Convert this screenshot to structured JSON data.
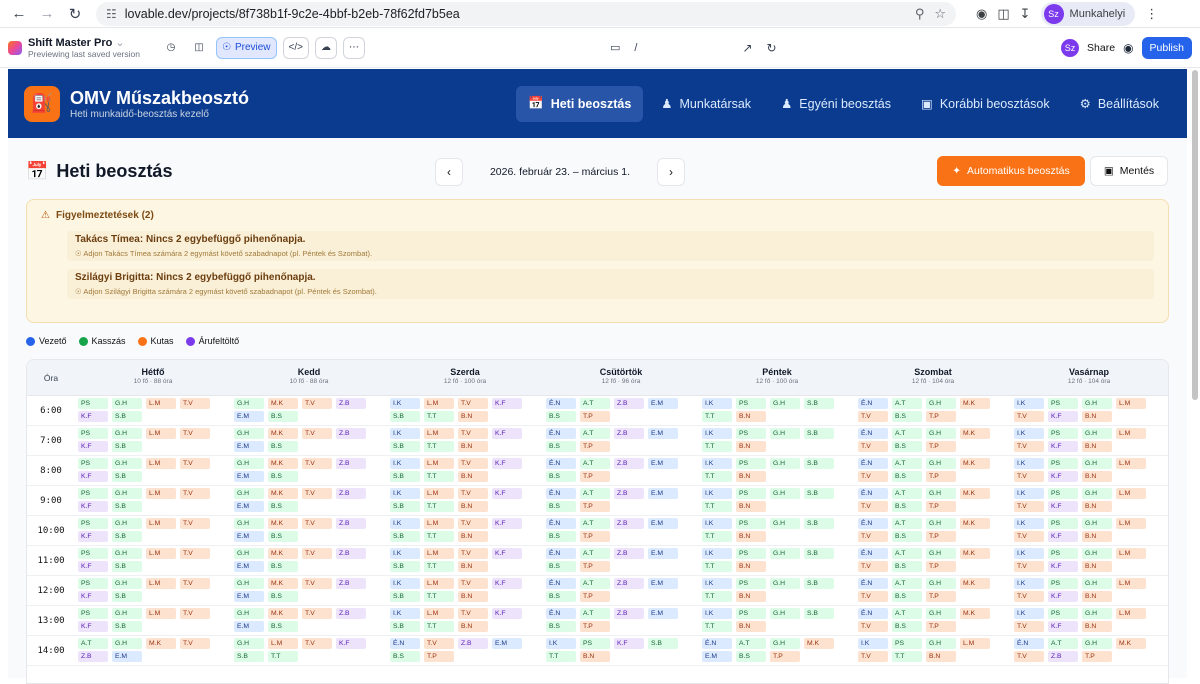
{
  "browser": {
    "url": "lovable.dev/projects/8f738b1f-9c2e-4bbf-b2eb-78f62fd7b5ea",
    "profile_initials": "Sz",
    "profile_name": "Munkahelyi"
  },
  "lovable": {
    "project_name": "Shift Master Pro",
    "project_sub": "Previewing last saved version",
    "preview_label": "Preview",
    "path": "/",
    "share_label": "Share",
    "publish_label": "Publish"
  },
  "app": {
    "title": "OMV Műszakbeosztó",
    "subtitle": "Heti munkaidő-beosztás kezelő",
    "nav": [
      {
        "label": "Heti beosztás",
        "icon": "calendar-icon"
      },
      {
        "label": "Munkatársak",
        "icon": "users-icon"
      },
      {
        "label": "Egyéni beosztás",
        "icon": "user-clock-icon"
      },
      {
        "label": "Korábbi beosztások",
        "icon": "archive-icon"
      },
      {
        "label": "Beállítások",
        "icon": "gear-icon"
      }
    ]
  },
  "page": {
    "title": "Heti beosztás",
    "week": "2026. február 23. – március 1.",
    "auto_label": "Automatikus beosztás",
    "save_label": "Mentés"
  },
  "warnings": {
    "title": "Figyelmeztetések (2)",
    "items": [
      {
        "title": "Takács Tímea: Nincs 2 egybefüggő pihenőnapja.",
        "hint": "Adjon Takács Tímea számára 2 egymást követő szabadnapot (pl. Péntek és Szombat)."
      },
      {
        "title": "Szilágyi Brigitta: Nincs 2 egybefüggő pihenőnapja.",
        "hint": "Adjon Szilágyi Brigitta számára 2 egymást követő szabadnapot (pl. Péntek és Szombat)."
      }
    ]
  },
  "legend": [
    {
      "label": "Vezető",
      "color": "#2563eb"
    },
    {
      "label": "Kasszás",
      "color": "#16a34a"
    },
    {
      "label": "Kutas",
      "color": "#f97316"
    },
    {
      "label": "Árufeltöltő",
      "color": "#7c3aed"
    }
  ],
  "table": {
    "hour_header": "Óra",
    "days": [
      {
        "name": "Hétfő",
        "meta": "10 fő · 88 óra"
      },
      {
        "name": "Kedd",
        "meta": "10 fő · 88 óra"
      },
      {
        "name": "Szerda",
        "meta": "12 fő · 100 óra"
      },
      {
        "name": "Csütörtök",
        "meta": "12 fő · 96 óra"
      },
      {
        "name": "Péntek",
        "meta": "12 fő · 100 óra"
      },
      {
        "name": "Szombat",
        "meta": "12 fő · 104 óra"
      },
      {
        "name": "Vasárnap",
        "meta": "12 fő · 104 óra"
      }
    ],
    "hours": [
      "6:00",
      "7:00",
      "8:00",
      "9:00",
      "10:00",
      "11:00",
      "12:00",
      "13:00",
      "14:00"
    ],
    "morning": [
      [
        [
          "PS",
          "K"
        ],
        [
          "G.H",
          "K"
        ],
        [
          "L.M",
          "C"
        ],
        [
          "T.V",
          "C"
        ],
        [
          "K.F",
          "A"
        ],
        [
          "S.B",
          "K"
        ]
      ],
      [
        [
          "G.H",
          "K"
        ],
        [
          "M.K",
          "C"
        ],
        [
          "T.V",
          "C"
        ],
        [
          "Z.B",
          "A"
        ],
        [
          "E.M",
          "V"
        ],
        [
          "B.S",
          "K"
        ]
      ],
      [
        [
          "I.K",
          "V"
        ],
        [
          "L.M",
          "C"
        ],
        [
          "T.V",
          "C"
        ],
        [
          "K.F",
          "A"
        ],
        [
          "S.B",
          "K"
        ],
        [
          "T.T",
          "K"
        ],
        [
          "B.N",
          "C"
        ]
      ],
      [
        [
          "É.N",
          "V"
        ],
        [
          "A.T",
          "K"
        ],
        [
          "Z.B",
          "A"
        ],
        [
          "E.M",
          "V"
        ],
        [
          "B.S",
          "K"
        ],
        [
          "T.P",
          "C"
        ]
      ],
      [
        [
          "I.K",
          "V"
        ],
        [
          "PS",
          "K"
        ],
        [
          "G.H",
          "K"
        ],
        [
          "S.B",
          "K"
        ],
        [
          "T.T",
          "K"
        ],
        [
          "B.N",
          "C"
        ]
      ],
      [
        [
          "É.N",
          "V"
        ],
        [
          "A.T",
          "K"
        ],
        [
          "G.H",
          "K"
        ],
        [
          "M.K",
          "C"
        ],
        [
          "T.V",
          "C"
        ],
        [
          "B.S",
          "K"
        ],
        [
          "T.P",
          "C"
        ]
      ],
      [
        [
          "I.K",
          "V"
        ],
        [
          "PS",
          "K"
        ],
        [
          "G.H",
          "K"
        ],
        [
          "L.M",
          "C"
        ],
        [
          "T.V",
          "C"
        ],
        [
          "K.F",
          "A"
        ],
        [
          "B.N",
          "C"
        ]
      ]
    ],
    "afternoon": [
      [
        [
          "A.T",
          "K"
        ],
        [
          "G.H",
          "K"
        ],
        [
          "M.K",
          "C"
        ],
        [
          "T.V",
          "C"
        ],
        [
          "Z.B",
          "A"
        ],
        [
          "E.M",
          "V"
        ]
      ],
      [
        [
          "G.H",
          "K"
        ],
        [
          "L.M",
          "C"
        ],
        [
          "T.V",
          "C"
        ],
        [
          "K.F",
          "A"
        ],
        [
          "S.B",
          "K"
        ],
        [
          "T.T",
          "K"
        ]
      ],
      [
        [
          "É.N",
          "V"
        ],
        [
          "T.V",
          "C"
        ],
        [
          "Z.B",
          "A"
        ],
        [
          "E.M",
          "V"
        ],
        [
          "B.S",
          "K"
        ],
        [
          "T.P",
          "C"
        ]
      ],
      [
        [
          "I.K",
          "V"
        ],
        [
          "PS",
          "K"
        ],
        [
          "K.F",
          "A"
        ],
        [
          "S.B",
          "K"
        ],
        [
          "T.T",
          "K"
        ],
        [
          "B.N",
          "C"
        ]
      ],
      [
        [
          "É.N",
          "V"
        ],
        [
          "A.T",
          "K"
        ],
        [
          "G.H",
          "K"
        ],
        [
          "M.K",
          "C"
        ],
        [
          "E.M",
          "V"
        ],
        [
          "B.S",
          "K"
        ],
        [
          "T.P",
          "C"
        ]
      ],
      [
        [
          "I.K",
          "V"
        ],
        [
          "PS",
          "K"
        ],
        [
          "G.H",
          "K"
        ],
        [
          "L.M",
          "C"
        ],
        [
          "T.V",
          "C"
        ],
        [
          "T.T",
          "K"
        ],
        [
          "B.N",
          "C"
        ]
      ],
      [
        [
          "É.N",
          "V"
        ],
        [
          "A.T",
          "K"
        ],
        [
          "G.H",
          "K"
        ],
        [
          "M.K",
          "C"
        ],
        [
          "T.V",
          "C"
        ],
        [
          "Z.B",
          "A"
        ],
        [
          "T.P",
          "C"
        ]
      ]
    ]
  }
}
